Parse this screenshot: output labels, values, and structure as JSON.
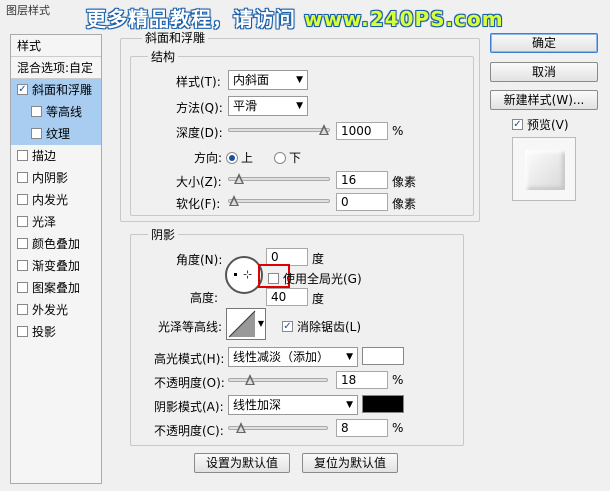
{
  "dialog": {
    "title": "图层样式"
  },
  "watermark": {
    "prefix": "更多精品教程，请访问 ",
    "url": "www.240PS.com"
  },
  "style_list": {
    "header": "样式",
    "blend_options": "混合选项:自定",
    "items": [
      {
        "label": "斜面和浮雕",
        "checked": true,
        "selected": true,
        "sub": false
      },
      {
        "label": "等高线",
        "checked": false,
        "selected": false,
        "sub": true
      },
      {
        "label": "纹理",
        "checked": false,
        "selected": false,
        "sub": true
      },
      {
        "label": "描边",
        "checked": false,
        "selected": false,
        "sub": false
      },
      {
        "label": "内阴影",
        "checked": false,
        "selected": false,
        "sub": false
      },
      {
        "label": "内发光",
        "checked": false,
        "selected": false,
        "sub": false
      },
      {
        "label": "光泽",
        "checked": false,
        "selected": false,
        "sub": false
      },
      {
        "label": "颜色叠加",
        "checked": false,
        "selected": false,
        "sub": false
      },
      {
        "label": "渐变叠加",
        "checked": false,
        "selected": false,
        "sub": false
      },
      {
        "label": "图案叠加",
        "checked": false,
        "selected": false,
        "sub": false
      },
      {
        "label": "外发光",
        "checked": false,
        "selected": false,
        "sub": false
      },
      {
        "label": "投影",
        "checked": false,
        "selected": false,
        "sub": false
      }
    ]
  },
  "bevel": {
    "section_title": "斜面和浮雕",
    "structure_title": "结构",
    "style_label": "样式(T):",
    "style_value": "内斜面",
    "technique_label": "方法(Q):",
    "technique_value": "平滑",
    "depth_label": "深度(D):",
    "depth_value": "1000",
    "depth_unit": "%",
    "depth_level": 1.0,
    "direction_label": "方向:",
    "direction_up": "上",
    "direction_down": "下",
    "size_label": "大小(Z):",
    "size_value": "16",
    "size_unit": "像素",
    "size_level": 0.06,
    "soften_label": "软化(F):",
    "soften_value": "0",
    "soften_unit": "像素",
    "soften_level": 0.0
  },
  "shading": {
    "title": "阴影",
    "angle_label": "角度(N):",
    "angle_value": "0",
    "angle_unit": "度",
    "global_light_label": "使用全局光(G)",
    "altitude_label": "高度:",
    "altitude_value": "40",
    "altitude_unit": "度",
    "gloss_label": "光泽等高线:",
    "antialias_label": "消除锯齿(L)",
    "highlight_label": "高光模式(H):",
    "highlight_value": "线性减淡（添加）",
    "highlight_color": "#ffffff",
    "highlight_opacity_label": "不透明度(O):",
    "highlight_opacity_value": "18",
    "highlight_opacity_unit": "%",
    "highlight_opacity_level": 0.18,
    "shadow_label": "阴影模式(A):",
    "shadow_value": "线性加深",
    "shadow_color": "#000000",
    "shadow_opacity_label": "不透明度(C):",
    "shadow_opacity_value": "8",
    "shadow_opacity_unit": "%",
    "shadow_opacity_level": 0.08
  },
  "buttons": {
    "ok": "确定",
    "cancel": "取消",
    "new_style": "新建样式(W)...",
    "preview": "预览(V)",
    "make_default": "设置为默认值",
    "reset_default": "复位为默认值"
  },
  "colors": {
    "selection": "#a8cdf0",
    "highlight_box": "#e00000",
    "accent": "#1a4fa0"
  }
}
